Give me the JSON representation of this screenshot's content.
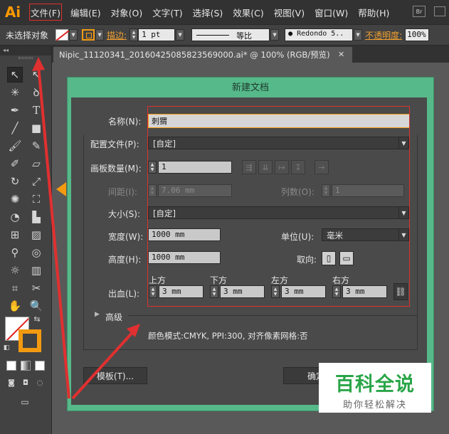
{
  "menubar": {
    "logo": "Ai",
    "items": [
      "文件(F)",
      "编辑(E)",
      "对象(O)",
      "文字(T)",
      "选择(S)",
      "效果(C)",
      "视图(V)",
      "窗口(W)",
      "帮助(H)"
    ],
    "bridge_label": "Br"
  },
  "controlbar": {
    "selection_label": "未选择对象",
    "stroke_label": "描边:",
    "stroke_weight": "1 pt",
    "stroke_profile": "等比",
    "brush": "Redondo 5..",
    "opacity_label": "不透明度:",
    "opacity_value": "100%"
  },
  "tools": {
    "collapse": "◂◂"
  },
  "document": {
    "tab_title": "Nipic_11120341_20160425085823569000.ai* @ 100% (RGB/预览)",
    "close": "✕"
  },
  "dialog": {
    "title": "新建文档",
    "name_label": "名称(N):",
    "name_value": "刺猬",
    "profile_label": "配置文件(P):",
    "profile_value": "[自定]",
    "artboards_label": "画板数量(M):",
    "artboards_value": "1",
    "spacing_label": "间距(I):",
    "spacing_value": "7.06 mm",
    "columns_label": "列数(O):",
    "columns_value": "1",
    "size_label": "大小(S):",
    "size_value": "[自定]",
    "width_label": "宽度(W):",
    "width_value": "1000 mm",
    "units_label": "单位(U):",
    "units_value": "毫米",
    "height_label": "高度(H):",
    "height_value": "1000 mm",
    "orientation_label": "取向:",
    "bleed_label": "出血(L):",
    "bleed_top_label": "上方",
    "bleed_bottom_label": "下方",
    "bleed_left_label": "左方",
    "bleed_right_label": "右方",
    "bleed_top": "3 mm",
    "bleed_bottom": "3 mm",
    "bleed_left": "3 mm",
    "bleed_right": "3 mm",
    "advanced_label": "高级",
    "color_info": "颜色模式:CMYK, PPI:300, 对齐像素网格:否",
    "template_button": "模板(T)...",
    "ok_button": "确定"
  },
  "watermark": {
    "title": "百科全说",
    "subtitle": "助你轻松解决"
  },
  "colors": {
    "accent_orange": "#f39a11",
    "dialog_frame_green": "#56b98a",
    "annotation_red": "#e03030"
  }
}
